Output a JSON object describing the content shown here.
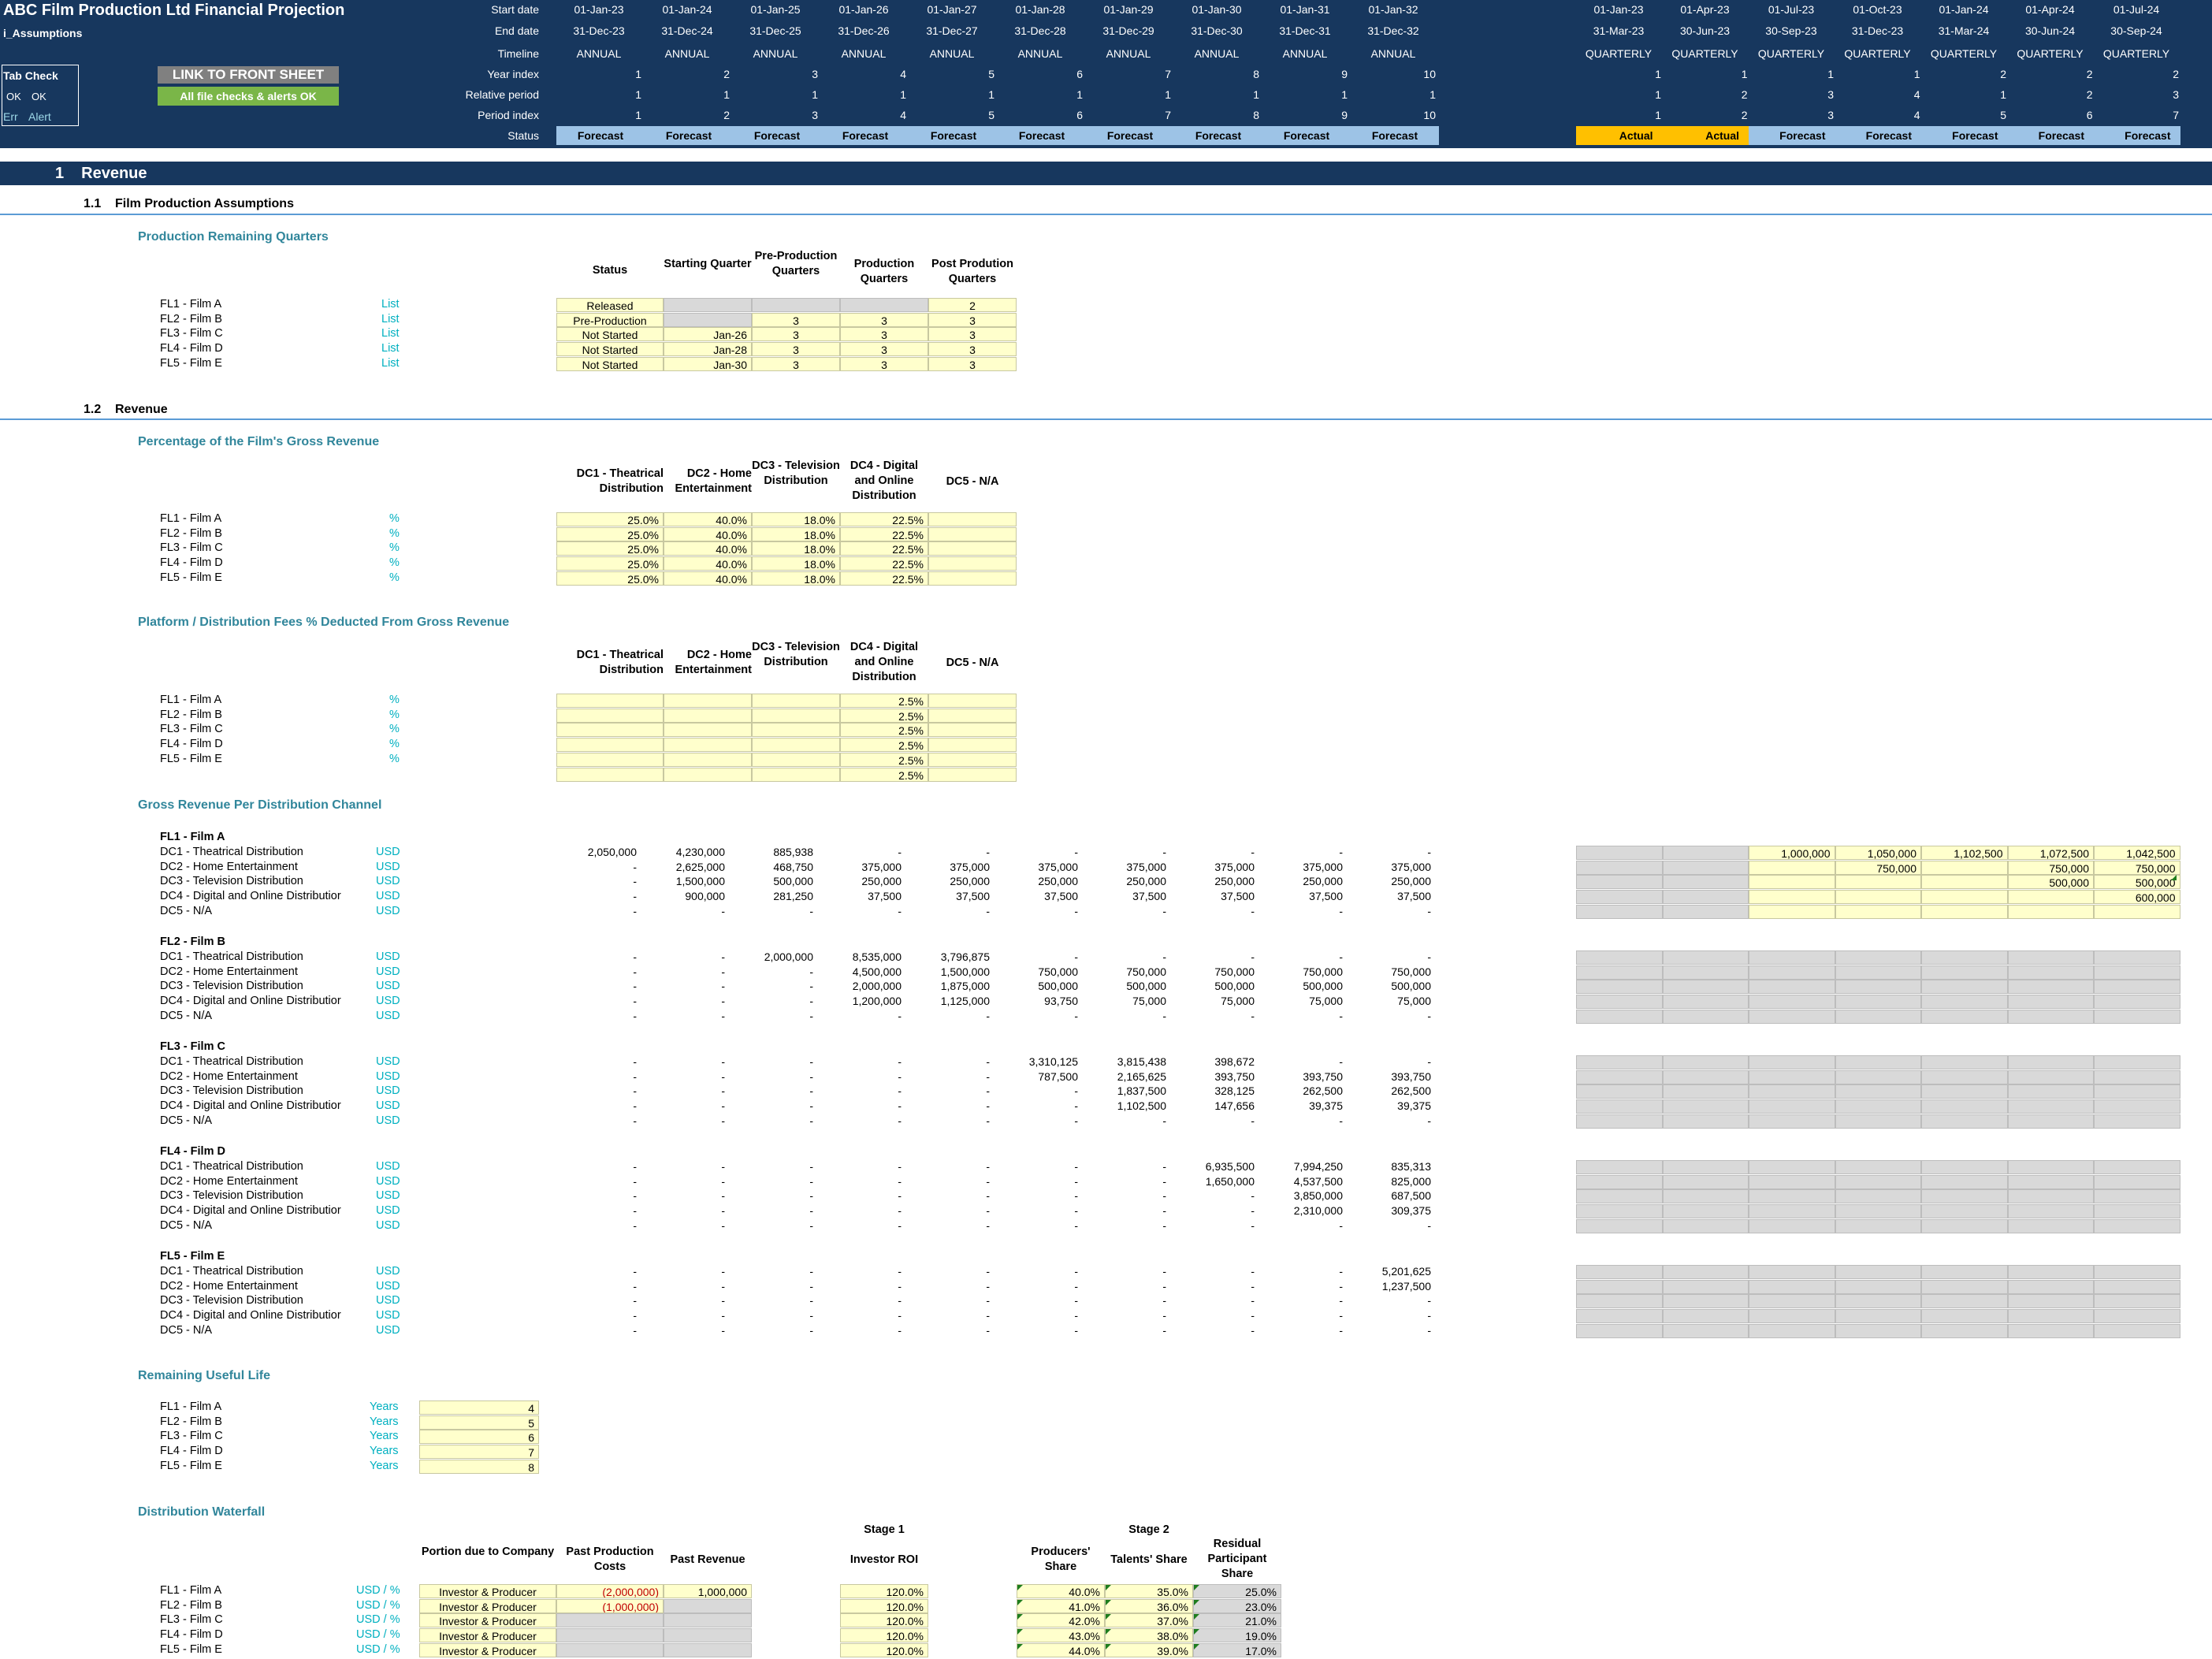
{
  "header": {
    "title": "ABC Film Production Ltd Financial Projection",
    "sheet": "i_Assumptions",
    "tab_check": "Tab Check",
    "ok1": "OK",
    "ok2": "OK",
    "err": "Err",
    "alert": "Alert",
    "link_button": "LINK TO FRONT SHEET",
    "checks_ok": "All file checks & alerts OK",
    "row_labels": [
      "Start date",
      "End date",
      "Timeline",
      "Year index",
      "Relative period",
      "Period index",
      "Status"
    ],
    "annual": {
      "start": [
        "01-Jan-23",
        "01-Jan-24",
        "01-Jan-25",
        "01-Jan-26",
        "01-Jan-27",
        "01-Jan-28",
        "01-Jan-29",
        "01-Jan-30",
        "01-Jan-31",
        "01-Jan-32"
      ],
      "end": [
        "31-Dec-23",
        "31-Dec-24",
        "31-Dec-25",
        "31-Dec-26",
        "31-Dec-27",
        "31-Dec-28",
        "31-Dec-29",
        "31-Dec-30",
        "31-Dec-31",
        "31-Dec-32"
      ],
      "timeline": "ANNUAL",
      "year_index": [
        "1",
        "2",
        "3",
        "4",
        "5",
        "6",
        "7",
        "8",
        "9",
        "10"
      ],
      "relative": [
        "1",
        "1",
        "1",
        "1",
        "1",
        "1",
        "1",
        "1",
        "1",
        "1"
      ],
      "period_index": [
        "1",
        "2",
        "3",
        "4",
        "5",
        "6",
        "7",
        "8",
        "9",
        "10"
      ],
      "status": "Forecast"
    },
    "quarterly": {
      "start": [
        "01-Jan-23",
        "01-Apr-23",
        "01-Jul-23",
        "01-Oct-23",
        "01-Jan-24",
        "01-Apr-24",
        "01-Jul-24"
      ],
      "end": [
        "31-Mar-23",
        "30-Jun-23",
        "30-Sep-23",
        "31-Dec-23",
        "31-Mar-24",
        "30-Jun-24",
        "30-Sep-24"
      ],
      "timeline": "QUARTERLY",
      "year_index": [
        "1",
        "1",
        "1",
        "1",
        "2",
        "2",
        "2"
      ],
      "relative": [
        "1",
        "2",
        "3",
        "4",
        "1",
        "2",
        "3"
      ],
      "period_index": [
        "1",
        "2",
        "3",
        "4",
        "5",
        "6",
        "7"
      ],
      "status": [
        "Actual",
        "Actual",
        "Forecast",
        "Forecast",
        "Forecast",
        "Forecast",
        "Forecast"
      ]
    }
  },
  "section1": {
    "num": "1",
    "title": "Revenue"
  },
  "sub11": {
    "num": "1.1",
    "title": "Film Production Assumptions"
  },
  "prod_quarters": {
    "title": "Production Remaining Quarters",
    "headers": [
      "Status",
      "Starting Quarter",
      "Pre-Production Quarters",
      "Production Quarters",
      "Post Prodution Quarters"
    ],
    "rows": [
      {
        "film": "FL1 - Film A",
        "unit": "List",
        "status": "Released",
        "start": "",
        "pre": "",
        "prod": "",
        "post": "2"
      },
      {
        "film": "FL2 - Film B",
        "unit": "List",
        "status": "Pre-Production",
        "start": "",
        "pre": "3",
        "prod": "3",
        "post": "3"
      },
      {
        "film": "FL3 - Film C",
        "unit": "List",
        "status": "Not Started",
        "start": "Jan-26",
        "pre": "3",
        "prod": "3",
        "post": "3"
      },
      {
        "film": "FL4 - Film D",
        "unit": "List",
        "status": "Not Started",
        "start": "Jan-28",
        "pre": "3",
        "prod": "3",
        "post": "3"
      },
      {
        "film": "FL5 - Film E",
        "unit": "List",
        "status": "Not Started",
        "start": "Jan-30",
        "pre": "3",
        "prod": "3",
        "post": "3"
      }
    ]
  },
  "sub12": {
    "num": "1.2",
    "title": "Revenue"
  },
  "dc_headers": [
    "DC1 - Theatrical Distribution",
    "DC2 - Home Entertainment",
    "DC3 - Television Distribution",
    "DC4 - Digital and Online Distribution",
    "DC5 - N/A"
  ],
  "pct_gross": {
    "title": "Percentage of the Film's Gross Revenue",
    "rows": [
      {
        "film": "FL1 - Film A",
        "unit": "%",
        "v": [
          "25.0%",
          "40.0%",
          "18.0%",
          "22.5%",
          ""
        ]
      },
      {
        "film": "FL2 - Film B",
        "unit": "%",
        "v": [
          "25.0%",
          "40.0%",
          "18.0%",
          "22.5%",
          ""
        ]
      },
      {
        "film": "FL3 - Film C",
        "unit": "%",
        "v": [
          "25.0%",
          "40.0%",
          "18.0%",
          "22.5%",
          ""
        ]
      },
      {
        "film": "FL4 - Film D",
        "unit": "%",
        "v": [
          "25.0%",
          "40.0%",
          "18.0%",
          "22.5%",
          ""
        ]
      },
      {
        "film": "FL5 - Film E",
        "unit": "%",
        "v": [
          "25.0%",
          "40.0%",
          "18.0%",
          "22.5%",
          ""
        ]
      }
    ]
  },
  "platform_fees": {
    "title": "Platform / Distribution Fees % Deducted From Gross Revenue",
    "rows": [
      {
        "film": "FL1 - Film A",
        "unit": "%",
        "v": [
          "",
          "",
          "",
          "2.5%",
          ""
        ]
      },
      {
        "film": "FL2 - Film B",
        "unit": "%",
        "v": [
          "",
          "",
          "",
          "2.5%",
          ""
        ]
      },
      {
        "film": "FL3 - Film C",
        "unit": "%",
        "v": [
          "",
          "",
          "",
          "2.5%",
          ""
        ]
      },
      {
        "film": "FL4 - Film D",
        "unit": "%",
        "v": [
          "",
          "",
          "",
          "2.5%",
          ""
        ]
      },
      {
        "film": "FL5 - Film E",
        "unit": "%",
        "v": [
          "",
          "",
          "",
          "2.5%",
          ""
        ]
      },
      {
        "film": "",
        "unit": "",
        "v": [
          "",
          "",
          "",
          "2.5%",
          ""
        ]
      }
    ]
  },
  "gross_rev": {
    "title": "Gross Revenue Per Distribution Channel",
    "channels": [
      "DC1 - Theatrical Distribution",
      "DC2 - Home Entertainment",
      "DC3 - Television Distribution",
      "DC4 - Digital and Online Distributior",
      "DC5 - N/A"
    ],
    "unit": "USD",
    "films": [
      {
        "name": "FL1 - Film A",
        "rows": [
          [
            "2,050,000",
            "4,230,000",
            "885,938",
            "-",
            "-",
            "-",
            "-",
            "-",
            "-",
            "-"
          ],
          [
            "-",
            "2,625,000",
            "468,750",
            "375,000",
            "375,000",
            "375,000",
            "375,000",
            "375,000",
            "375,000",
            "375,000"
          ],
          [
            "-",
            "1,500,000",
            "500,000",
            "250,000",
            "250,000",
            "250,000",
            "250,000",
            "250,000",
            "250,000",
            "250,000"
          ],
          [
            "-",
            "900,000",
            "281,250",
            "37,500",
            "37,500",
            "37,500",
            "37,500",
            "37,500",
            "37,500",
            "37,500"
          ],
          [
            "-",
            "-",
            "-",
            "-",
            "-",
            "-",
            "-",
            "-",
            "-",
            "-"
          ]
        ],
        "q": [
          [
            "",
            "",
            "1,000,000",
            "1,050,000",
            "1,102,500",
            "1,072,500",
            "1,042,500"
          ],
          [
            "",
            "",
            "",
            "750,000",
            "",
            "750,000",
            "750,000"
          ],
          [
            "",
            "",
            "",
            "",
            "",
            "500,000",
            "500,000"
          ],
          [
            "",
            "",
            "",
            "",
            "",
            "",
            "600,000"
          ],
          [
            "",
            "",
            "",
            "",
            "",
            "",
            ""
          ]
        ]
      },
      {
        "name": "FL2 - Film B",
        "rows": [
          [
            "-",
            "-",
            "2,000,000",
            "8,535,000",
            "3,796,875",
            "-",
            "-",
            "-",
            "-",
            "-"
          ],
          [
            "-",
            "-",
            "-",
            "4,500,000",
            "1,500,000",
            "750,000",
            "750,000",
            "750,000",
            "750,000",
            "750,000"
          ],
          [
            "-",
            "-",
            "-",
            "2,000,000",
            "1,875,000",
            "500,000",
            "500,000",
            "500,000",
            "500,000",
            "500,000"
          ],
          [
            "-",
            "-",
            "-",
            "1,200,000",
            "1,125,000",
            "93,750",
            "75,000",
            "75,000",
            "75,000",
            "75,000"
          ],
          [
            "-",
            "-",
            "-",
            "-",
            "-",
            "-",
            "-",
            "-",
            "-",
            "-"
          ]
        ]
      },
      {
        "name": "FL3 - Film C",
        "rows": [
          [
            "-",
            "-",
            "-",
            "-",
            "-",
            "3,310,125",
            "3,815,438",
            "398,672",
            "-",
            "-"
          ],
          [
            "-",
            "-",
            "-",
            "-",
            "-",
            "787,500",
            "2,165,625",
            "393,750",
            "393,750",
            "393,750"
          ],
          [
            "-",
            "-",
            "-",
            "-",
            "-",
            "-",
            "1,837,500",
            "328,125",
            "262,500",
            "262,500"
          ],
          [
            "-",
            "-",
            "-",
            "-",
            "-",
            "-",
            "1,102,500",
            "147,656",
            "39,375",
            "39,375"
          ],
          [
            "-",
            "-",
            "-",
            "-",
            "-",
            "-",
            "-",
            "-",
            "-",
            "-"
          ]
        ]
      },
      {
        "name": "FL4 - Film D",
        "rows": [
          [
            "-",
            "-",
            "-",
            "-",
            "-",
            "-",
            "-",
            "6,935,500",
            "7,994,250",
            "835,313"
          ],
          [
            "-",
            "-",
            "-",
            "-",
            "-",
            "-",
            "-",
            "1,650,000",
            "4,537,500",
            "825,000"
          ],
          [
            "-",
            "-",
            "-",
            "-",
            "-",
            "-",
            "-",
            "-",
            "3,850,000",
            "687,500"
          ],
          [
            "-",
            "-",
            "-",
            "-",
            "-",
            "-",
            "-",
            "-",
            "2,310,000",
            "309,375"
          ],
          [
            "-",
            "-",
            "-",
            "-",
            "-",
            "-",
            "-",
            "-",
            "-",
            "-"
          ]
        ]
      },
      {
        "name": "FL5 - Film E",
        "rows": [
          [
            "-",
            "-",
            "-",
            "-",
            "-",
            "-",
            "-",
            "-",
            "-",
            "5,201,625"
          ],
          [
            "-",
            "-",
            "-",
            "-",
            "-",
            "-",
            "-",
            "-",
            "-",
            "1,237,500"
          ],
          [
            "-",
            "-",
            "-",
            "-",
            "-",
            "-",
            "-",
            "-",
            "-",
            "-"
          ],
          [
            "-",
            "-",
            "-",
            "-",
            "-",
            "-",
            "-",
            "-",
            "-",
            "-"
          ],
          [
            "-",
            "-",
            "-",
            "-",
            "-",
            "-",
            "-",
            "-",
            "-",
            "-"
          ]
        ]
      }
    ]
  },
  "useful_life": {
    "title": "Remaining Useful Life",
    "rows": [
      {
        "film": "FL1 - Film A",
        "unit": "Years",
        "v": "4"
      },
      {
        "film": "FL2 - Film B",
        "unit": "Years",
        "v": "5"
      },
      {
        "film": "FL3 - Film C",
        "unit": "Years",
        "v": "6"
      },
      {
        "film": "FL4 - Film D",
        "unit": "Years",
        "v": "7"
      },
      {
        "film": "FL5 - Film E",
        "unit": "Years",
        "v": "8"
      }
    ]
  },
  "waterfall": {
    "title": "Distribution Waterfall",
    "stage1": "Stage 1",
    "stage2": "Stage 2",
    "headers": [
      "Portion due to Company",
      "Past Production Costs",
      "Past Revenue",
      "Investor ROI",
      "Producers' Share",
      "Talents' Share",
      "Residual Participant Share"
    ],
    "rows": [
      {
        "film": "FL1 - Film A",
        "unit": "USD / %",
        "portion": "Investor & Producer",
        "costs": "(2,000,000)",
        "rev": "1,000,000",
        "roi": "120.0%",
        "prod": "40.0%",
        "tal": "35.0%",
        "res": "25.0%"
      },
      {
        "film": "FL2 - Film B",
        "unit": "USD / %",
        "portion": "Investor & Producer",
        "costs": "(1,000,000)",
        "rev": "",
        "roi": "120.0%",
        "prod": "41.0%",
        "tal": "36.0%",
        "res": "23.0%"
      },
      {
        "film": "FL3 - Film C",
        "unit": "USD / %",
        "portion": "Investor & Producer",
        "costs": "",
        "rev": "",
        "roi": "120.0%",
        "prod": "42.0%",
        "tal": "37.0%",
        "res": "21.0%"
      },
      {
        "film": "FL4 - Film D",
        "unit": "USD / %",
        "portion": "Investor & Producer",
        "costs": "",
        "rev": "",
        "roi": "120.0%",
        "prod": "43.0%",
        "tal": "38.0%",
        "res": "19.0%"
      },
      {
        "film": "FL5 - Film E",
        "unit": "USD / %",
        "portion": "Investor & Producer",
        "costs": "",
        "rev": "",
        "roi": "120.0%",
        "prod": "44.0%",
        "tal": "39.0%",
        "res": "17.0%"
      }
    ]
  },
  "colors": {
    "header_bg": "#17375e",
    "forecast": "#9dc3e6",
    "actual": "#ffc000",
    "input": "#ffffcc",
    "link": "#31869b"
  }
}
